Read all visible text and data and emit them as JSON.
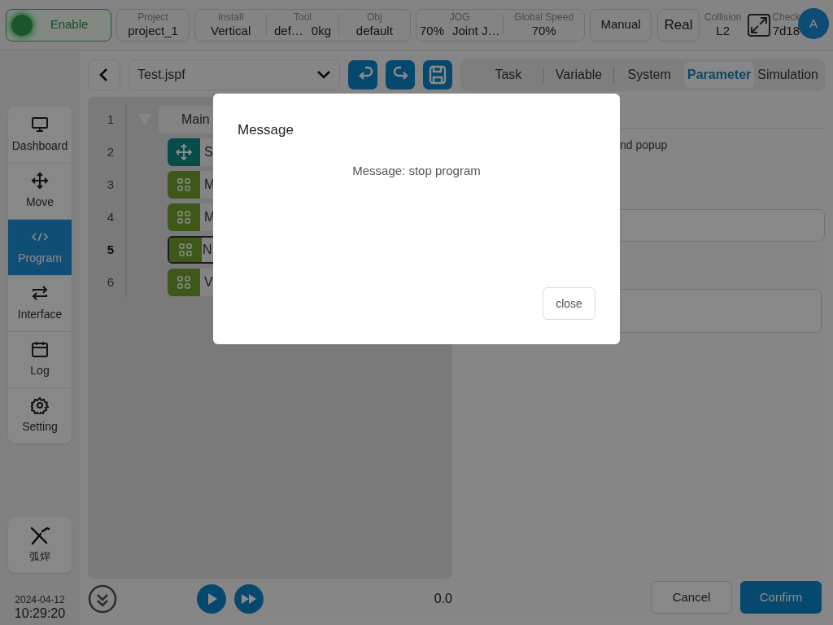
{
  "top_bar": {
    "enable": {
      "label": "Enable",
      "on": true
    },
    "project": {
      "label": "Project",
      "value": "project_1"
    },
    "install_group": [
      {
        "label": "Install",
        "values": [
          "Vertical"
        ]
      },
      {
        "label": "Tool",
        "values": [
          "def…",
          "0kg"
        ]
      },
      {
        "label": "Obj",
        "values": [
          "default"
        ]
      }
    ],
    "jog_group": [
      {
        "label": "JOG",
        "values": [
          "70%",
          "Joint J…"
        ]
      },
      {
        "label": "Global Speed",
        "values": [
          "70%"
        ]
      }
    ],
    "mode_button": "Manual",
    "real_button": "Real",
    "collision": {
      "label": "Collision",
      "value": "L2"
    },
    "check": {
      "label": "Check",
      "value": "7d18"
    },
    "avatar": "A"
  },
  "sidebar": {
    "items": [
      {
        "label": "Dashboard",
        "selected": false
      },
      {
        "label": "Move",
        "selected": false
      },
      {
        "label": "Program",
        "selected": true
      },
      {
        "label": "Interface",
        "selected": false
      },
      {
        "label": "Log",
        "selected": false
      },
      {
        "label": "Setting",
        "selected": false
      }
    ],
    "plugin": {
      "label": "弧焊"
    },
    "date": "2024-04-12",
    "time": "10:29:20"
  },
  "toolbar": {
    "file": "Test.jspf"
  },
  "tabs": [
    {
      "label": "Task",
      "selected": false
    },
    {
      "label": "Variable",
      "selected": false
    },
    {
      "label": "System",
      "selected": false
    },
    {
      "label": "Parameter",
      "selected": true
    },
    {
      "label": "Simulation",
      "selected": false
    }
  ],
  "program_tree": [
    {
      "line": "1",
      "kind": "main",
      "label": "Main",
      "expanded": true
    },
    {
      "line": "2",
      "kind": "move",
      "label": "S",
      "selected": false
    },
    {
      "line": "3",
      "kind": "block",
      "label": "M",
      "selected": false
    },
    {
      "line": "4",
      "kind": "block",
      "label": "M",
      "selected": false
    },
    {
      "line": "5",
      "kind": "block",
      "label": "N",
      "selected": true
    },
    {
      "line": "6",
      "kind": "block",
      "label": "V",
      "selected": false
    }
  ],
  "playback": {
    "speed": "0.0"
  },
  "parameter_panel": {
    "partial_text": "nd popup",
    "buttons": [
      "Cancel",
      "Confirm"
    ]
  },
  "dialog": {
    "title": "Message",
    "message": "Message: stop program",
    "button": "close"
  }
}
